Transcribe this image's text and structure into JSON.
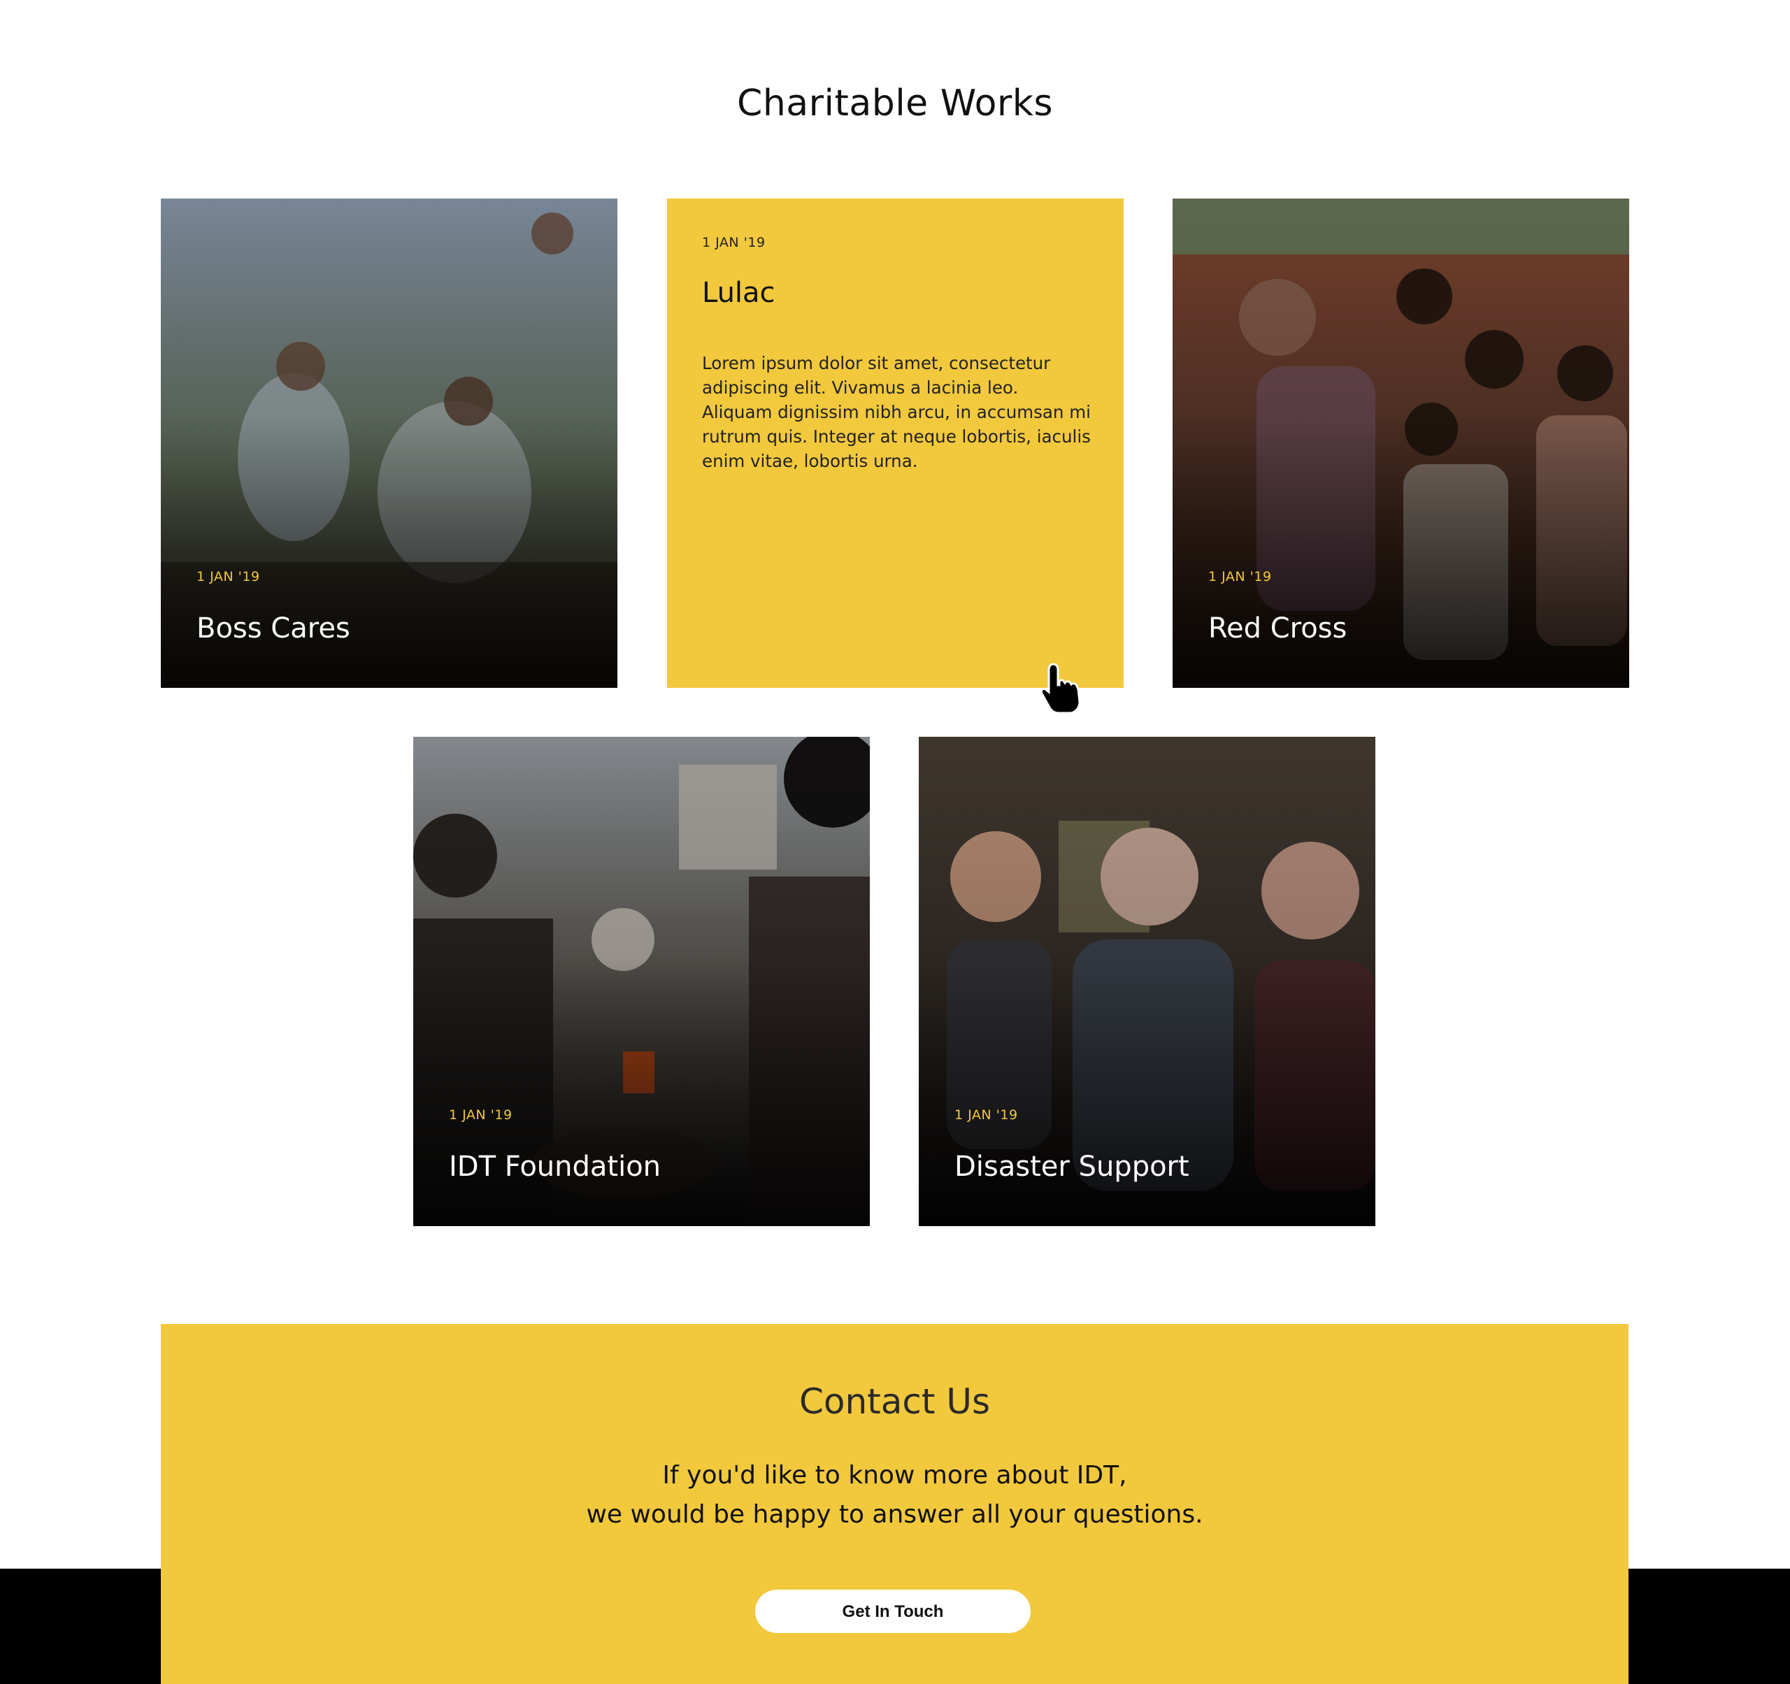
{
  "section": {
    "title": "Charitable Works"
  },
  "cards": [
    {
      "date": "1 JAN '19",
      "title": "Boss Cares"
    },
    {
      "date": "1 JAN '19",
      "title": "Lulac",
      "text": "Lorem ipsum dolor sit amet, consectetur adipiscing elit. Vivamus a lacinia leo. Aliquam dignissim nibh arcu, in accumsan mi rutrum quis. Integer at neque lobortis, iaculis enim vitae, lobortis urna."
    },
    {
      "date": "1 JAN '19",
      "title": "Red Cross"
    },
    {
      "date": "1 JAN '19",
      "title": "IDT Foundation"
    },
    {
      "date": "1 JAN '19",
      "title": "Disaster Support"
    }
  ],
  "contact": {
    "title": "Contact Us",
    "line1": "If you'd like to know more about IDT,",
    "line2": "we would be happy to answer all your questions.",
    "button": "Get In Touch"
  },
  "colors": {
    "accent": "#f2c83d",
    "footer": "#000000",
    "card_text": "#ffffff"
  },
  "icons": {
    "cursor": "pointer-hand-icon"
  }
}
